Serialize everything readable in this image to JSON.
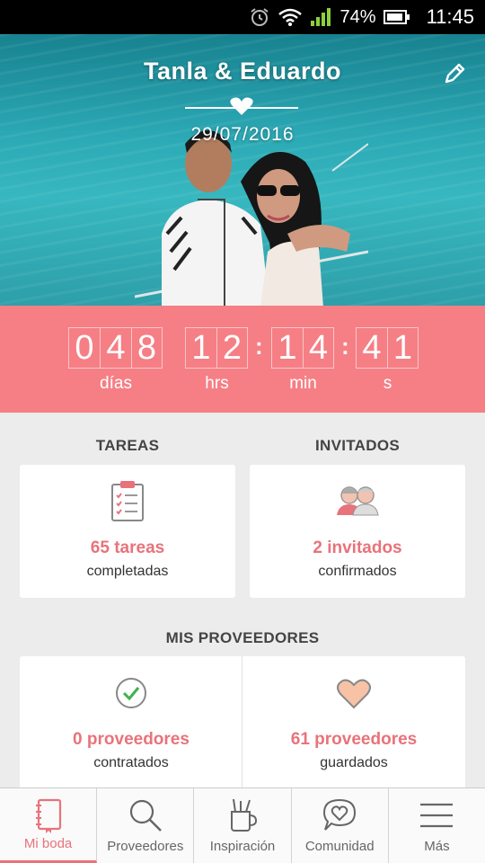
{
  "status_bar": {
    "battery": "74%",
    "time": "11:45"
  },
  "hero": {
    "couple_names": "Tanla & Eduardo",
    "wedding_date": "29/07/2016"
  },
  "countdown": {
    "days_digits": [
      "0",
      "4",
      "8"
    ],
    "hours_digits": [
      "1",
      "2"
    ],
    "minutes_digits": [
      "1",
      "4"
    ],
    "seconds_digits": [
      "4",
      "1"
    ],
    "days_label": "días",
    "hours_label": "hrs",
    "minutes_label": "min",
    "seconds_label": "s"
  },
  "tasks": {
    "title": "TAREAS",
    "count": "65 tareas",
    "sub": "completadas"
  },
  "guests": {
    "title": "INVITADOS",
    "count": "2 invitados",
    "sub": "confirmados"
  },
  "vendors": {
    "title": "MIS PROVEEDORES",
    "hired": {
      "count": "0 proveedores",
      "sub": "contratados"
    },
    "saved": {
      "count": "61 proveedores",
      "sub": "guardados"
    }
  },
  "nav": {
    "items": [
      {
        "label": "Mi boda",
        "icon": "notebook-icon"
      },
      {
        "label": "Proveedores",
        "icon": "search-icon"
      },
      {
        "label": "Inspiración",
        "icon": "toolcup-icon"
      },
      {
        "label": "Comunidad",
        "icon": "chat-heart-icon"
      },
      {
        "label": "Más",
        "icon": "menu-icon"
      }
    ]
  },
  "colors": {
    "accent": "#f57f85",
    "accent_text": "#e8737a",
    "background": "#ececec"
  }
}
